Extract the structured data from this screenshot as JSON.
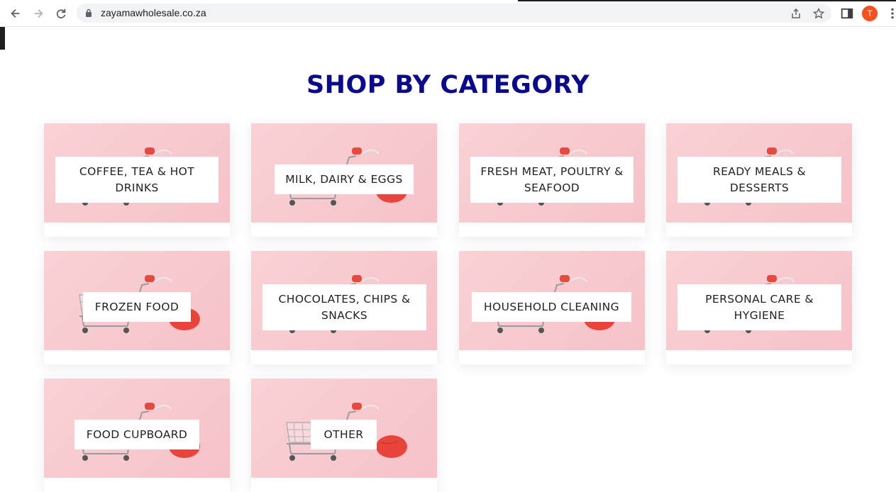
{
  "browser": {
    "url": "zayamawholesale.co.za",
    "profile_initial": "T"
  },
  "page": {
    "heading": "SHOP BY CATEGORY"
  },
  "categories": [
    {
      "label": "COFFEE, TEA & HOT DRINKS"
    },
    {
      "label": "MILK, DAIRY & EGGS"
    },
    {
      "label": "FRESH MEAT, POULTRY & SEAFOOD"
    },
    {
      "label": "READY MEALS & DESSERTS"
    },
    {
      "label": "FROZEN FOOD"
    },
    {
      "label": "CHOCOLATES, CHIPS & SNACKS"
    },
    {
      "label": "HOUSEHOLD CLEANING"
    },
    {
      "label": "PERSONAL CARE & HYGIENE"
    },
    {
      "label": "FOOD CUPBOARD"
    },
    {
      "label": "OTHER"
    }
  ],
  "colors": {
    "heading": "#0b0a8a",
    "card_bg": "#f7c9ce",
    "mouse": "#e8443b"
  }
}
